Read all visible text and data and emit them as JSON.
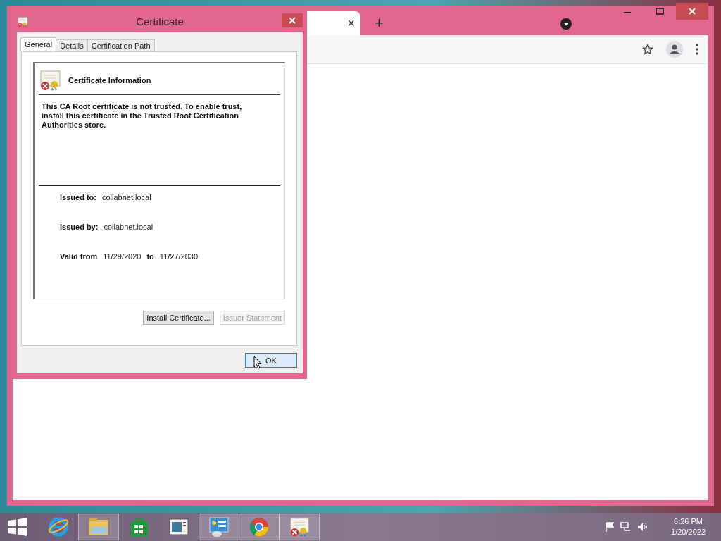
{
  "browser": {
    "tab": {
      "close": "×"
    },
    "new_tab": "+"
  },
  "dialog": {
    "title": "Certificate",
    "tabs": [
      {
        "label": "General",
        "selected": true
      },
      {
        "label": "Details",
        "selected": false
      },
      {
        "label": "Certification Path",
        "selected": false
      }
    ],
    "heading": "Certificate Information",
    "message": "This CA Root certificate is not trusted. To enable trust, install this certificate in the Trusted Root Certification Authorities store.",
    "fields": [
      {
        "label": "Issued to:",
        "value": "collabnet.local"
      },
      {
        "label": "Issued by:",
        "value": "collabnet.local"
      }
    ],
    "validity": {
      "label": "Valid from",
      "from": "11/29/2020",
      "joiner": "to",
      "to": "11/27/2030"
    },
    "buttons": [
      {
        "label": "Install Certificate...",
        "disabled": false
      },
      {
        "label": "Issuer Statement",
        "disabled": true
      }
    ],
    "ok": {
      "label": "OK"
    }
  },
  "taskbar": {
    "apps": [
      {
        "kind": "ie",
        "running": false
      },
      {
        "kind": "explorer",
        "running": true
      },
      {
        "kind": "store",
        "running": false
      },
      {
        "kind": "document",
        "running": false
      },
      {
        "kind": "panel",
        "running": true
      },
      {
        "kind": "chrome",
        "running": true
      },
      {
        "kind": "certificate",
        "running": true
      }
    ],
    "time": "6:26 PM",
    "date": "1/20/2022"
  }
}
